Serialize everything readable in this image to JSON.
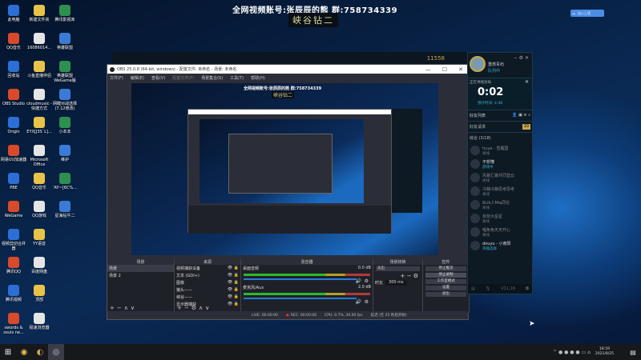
{
  "overlay": {
    "line1": "全网视频账号:张辰辰的熊  群:758734339",
    "line2": "峡谷钻二",
    "badge": "加入上墙"
  },
  "desktop_icons": [
    [
      "此电脑",
      "新建文件夹",
      "腾讯影视库"
    ],
    [
      "QQ音乐",
      "16086014...",
      "英雄联盟"
    ],
    [
      "回收站",
      "斗鱼直播伴侣",
      "英雄联盟WeGame版"
    ],
    [
      "OBS Studio",
      "cloudmusic - 快捷方式",
      "网睫对战选择(7.12修改)"
    ],
    [
      "Origin",
      "EYX[J3S`L]...",
      "小本本"
    ],
    [
      "网易UU加速器",
      "Microsoft Office",
      "维护"
    ],
    [
      "PBE",
      "QQ音乐",
      "'AY~[6C%..."
    ],
    [
      "WeGame",
      "QQ游戏",
      "星海钻牛二"
    ],
    [
      "视频剪切合并器",
      "YY语音",
      ""
    ],
    [
      "腾讯QQ",
      "百度网盘",
      ""
    ],
    [
      "腾讯视频",
      "顶部",
      ""
    ],
    [
      "swords & souls ne...",
      "极速浏览器",
      ""
    ]
  ],
  "colors": [
    "#2b6fd6",
    "#e8c34a",
    "#2f8f4f",
    "#d84a2a",
    "#e5e5e5",
    "#3a7bd5"
  ],
  "game_bar": {
    "currency": "11558"
  },
  "obs": {
    "title": "OBS 25.0.8 (64-bit, windows) - 配置文件: 未命名 - 场景: 未命名",
    "window_controls": [
      "—",
      "☐",
      "✕"
    ],
    "menu": [
      "文件(F)",
      "编辑(E)",
      "查看(V)",
      "配置文件(P)",
      "场景集合(S)",
      "工具(T)",
      "帮助(H)"
    ],
    "preview": {
      "line1": "全网视频账号:张辰辰的熊  群:758734339",
      "line2": "峡谷钻二"
    },
    "docks": {
      "scenes": {
        "title": "场景",
        "items": [
          "场景",
          "场景 2"
        ]
      },
      "sources": {
        "title": "来源",
        "items": [
          "视频捕获设备",
          "文本 (GDI+)",
          "图像",
          "猪头——",
          "峡谷——",
          "显示器捕获"
        ]
      },
      "mixer": {
        "title": "混音器",
        "channels": [
          {
            "name": "桌面音频",
            "db": "0.0 dB"
          },
          {
            "name": "麦克风/Aux",
            "db": "2.0 dB"
          }
        ]
      },
      "transitions": {
        "title": "场景转换",
        "type": "淡出",
        "duration_label": "时长",
        "duration": "300 ms"
      },
      "controls": {
        "title": "控件",
        "buttons": [
          "停止推流",
          "停止录制",
          "工作室模式",
          "设置",
          "退出"
        ]
      }
    },
    "status": {
      "live": "LIVE: 00:00:00",
      "rec": "REC: 00:00:00",
      "cpu": "CPU: 0.7%, 30.00 fps",
      "delay": "延迟 (在 25 秒后开始)"
    }
  },
  "panel": {
    "player": "重燃青屿",
    "player_status": "队列中",
    "queue_label": "正在寻找对局",
    "timer": "0:02",
    "estimate": "预计时间: 4:48",
    "friends_title": "好友列表",
    "requests": "好友请求",
    "requests_count": "10",
    "group": "综合 (3/18)",
    "friends": [
      {
        "name": "huya - 雪雁国",
        "status": "离线"
      },
      {
        "name": "不想懂",
        "status": "游戏中"
      },
      {
        "name": "风暴汇聚共同登云",
        "status": "离线"
      },
      {
        "name": "冷静冷静思考思考",
        "status": "离线"
      },
      {
        "name": "8Lib人Mia同伦",
        "status": "离线"
      },
      {
        "name": "叔叔大星星",
        "status": "离线"
      },
      {
        "name": "唱免免天天开心",
        "status": "离线"
      },
      {
        "name": "douyu - 小南阳",
        "status": "英雄选择"
      }
    ],
    "version": "V11.16"
  },
  "taskbar": {
    "time": "18:59",
    "date": "2021/8/25"
  }
}
